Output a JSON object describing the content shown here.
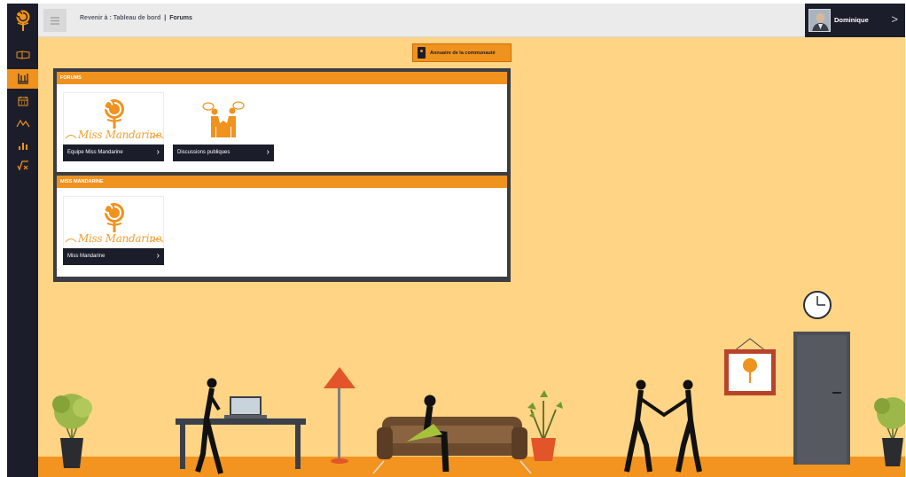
{
  "colors": {
    "accent": "#f0921e",
    "dark": "#1b1e2a",
    "wall": "#ffd484"
  },
  "rail": {
    "items": [
      {
        "icon": "book-icon",
        "active": false
      },
      {
        "icon": "forum-icon",
        "active": true
      },
      {
        "icon": "calendar-icon",
        "active": false
      },
      {
        "icon": "activity-icon",
        "active": false
      },
      {
        "icon": "stats-icon",
        "active": false
      },
      {
        "icon": "formula-icon",
        "active": false
      }
    ]
  },
  "topbar": {
    "menu_icon": "hamburger-icon",
    "breadcrumb_back": "Revenir à : Tableau de bord",
    "breadcrumb_separator": "|",
    "breadcrumb_current": "Forums",
    "user_name": "Dominique",
    "user_chevron": ">"
  },
  "directory_button": {
    "label": "Annuaire de la communauté",
    "icon": "directory-icon"
  },
  "sections": [
    {
      "title": "FORUMS",
      "tiles": [
        {
          "label": "Equipe Miss Mandarine",
          "image_text": "Miss Mandarine",
          "image": "miss-mandarine-logo"
        },
        {
          "label": "Discussions publiques",
          "image_text": "",
          "image": "people-talking"
        }
      ]
    },
    {
      "title": "MISS MANDARINE",
      "tiles": [
        {
          "label": "Miss Mandarine",
          "image_text": "Miss Mandarine",
          "image": "miss-mandarine-logo"
        }
      ]
    }
  ]
}
